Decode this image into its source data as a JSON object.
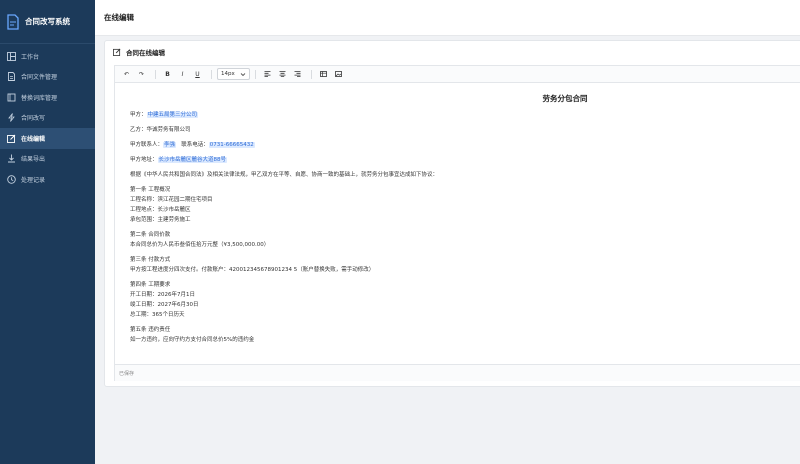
{
  "sidebar": {
    "title": "合同改写系统",
    "items": [
      {
        "label": "工作台",
        "icon": "dashboard-icon"
      },
      {
        "label": "合同文件管理",
        "icon": "file-icon"
      },
      {
        "label": "替换词库管理",
        "icon": "book-icon"
      },
      {
        "label": "合同改写",
        "icon": "lightning-icon"
      },
      {
        "label": "在线编辑",
        "icon": "edit-icon",
        "active": true
      },
      {
        "label": "结果导出",
        "icon": "download-icon"
      },
      {
        "label": "处理记录",
        "icon": "history-icon"
      }
    ]
  },
  "topbar": {
    "title": "在线编辑"
  },
  "card": {
    "title": "合同在线编辑"
  },
  "toolbar": {
    "undo": "↶",
    "redo": "↷",
    "bold": "B",
    "italic": "I",
    "underline": "U",
    "font_size": "14px",
    "align_left": "≡",
    "align_center": "≡",
    "align_right": "≡"
  },
  "doc": {
    "title": "劳务分包合同",
    "party_a_label": "甲方：",
    "party_a_value": "中建五局第三分公司",
    "party_b": "乙方：华诚劳务有限公司",
    "contact_label": "甲方联系人：",
    "contact_value": "李强",
    "phone_label": "联系电话：",
    "phone_value": "0731-66665432",
    "address_label": "甲方地址：",
    "address_value": "长沙市岳麓区麓谷大道88号",
    "intro": "根据《中华人民共和国合同法》及相关法律法规，甲乙双方在平等、自愿、协商一致的基础上，就劳务分包事宜达成如下协议：",
    "s1_title": "第一条 工程概况",
    "s1_l1": "工程名称：滨江花园二期住宅项目",
    "s1_l2": "工程地点：长沙市岳麓区",
    "s1_l3": "承包范围：主建劳务施工",
    "s2_title": "第二条 合同价款",
    "s2_l1": "本合同总价为人民币叁佰伍拾万元整（¥3,500,000.00）",
    "s3_title": "第三条 付款方式",
    "s3_l1": "甲方按工程进度分四次支付。付款账户：420012345678901234 5（账户替换失败，需手动修改）",
    "s4_title": "第四条 工期要求",
    "s4_l1": "开工日期：2026年7月1日",
    "s4_l2": "竣工日期：2027年6月30日",
    "s4_l3": "总工期：365个日历天",
    "s5_title": "第五条 违约责任",
    "s5_l1": "如一方违约，应向守约方支付合同总价5%的违约金"
  },
  "status": {
    "text": "已保存"
  },
  "colors": {
    "sidebar_bg": "#1c3a5a",
    "highlight_bg": "#dbe9ff",
    "highlight_text": "#2d6bd6"
  }
}
